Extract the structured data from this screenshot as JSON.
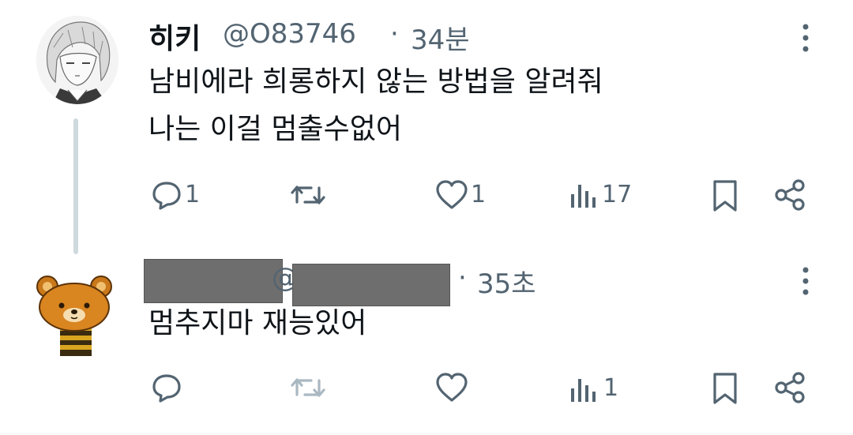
{
  "tweet": {
    "author_name": "히키",
    "handle": "@O83746",
    "separator": "·",
    "time": "34분",
    "text_line1": "남비에라 희롱하지 않는 방법을 알려줘",
    "text_line2": "나는 이걸 멈출수없어",
    "actions": {
      "reply_count": "1",
      "retweet_count": "",
      "like_count": "1",
      "views_count": "17"
    }
  },
  "reply": {
    "handle_prefix": "@",
    "separator": "·",
    "time": "35초",
    "text": "멈추지마 재능있어",
    "actions": {
      "reply_count": "",
      "retweet_count": "",
      "like_count": "",
      "views_count": "1"
    }
  },
  "colors": {
    "text": "#0f1419",
    "muted": "#536471",
    "thread_line": "#cfd9de",
    "redaction": "#6e6e6e"
  },
  "icons": [
    "comment-icon",
    "retweet-icon",
    "heart-icon",
    "views-icon",
    "bookmark-icon",
    "share-icon",
    "more-vertical-icon"
  ]
}
